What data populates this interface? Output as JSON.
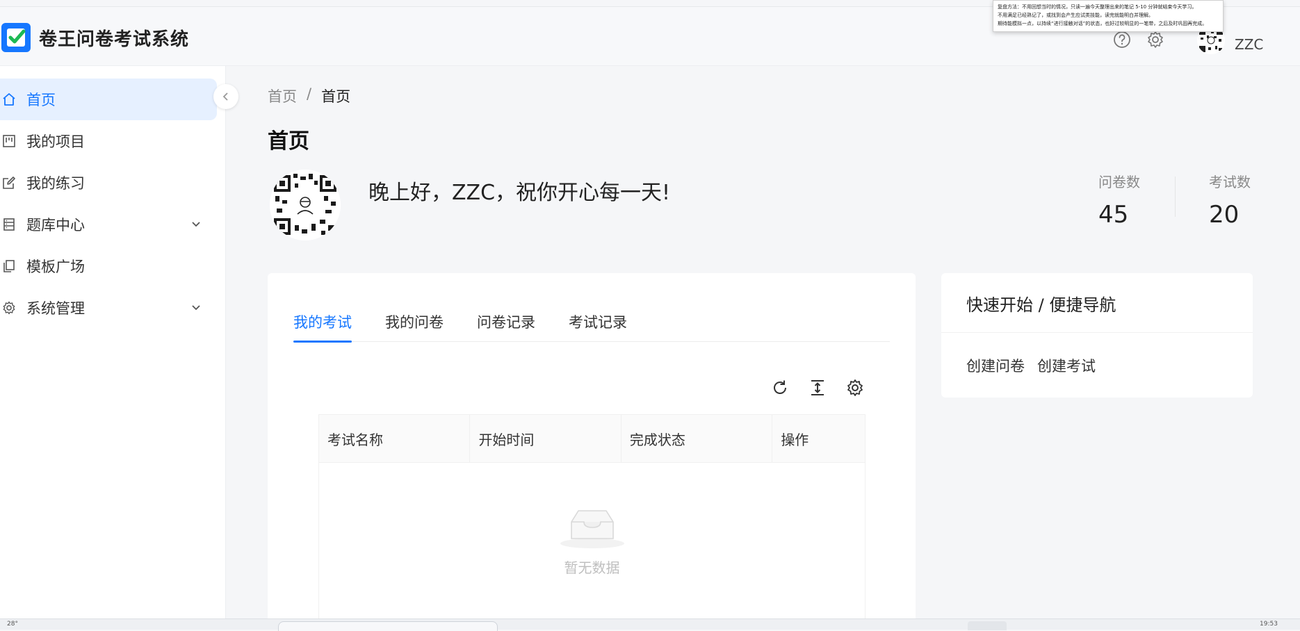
{
  "app": {
    "title": "卷王问卷考试系统",
    "username": "ZZC"
  },
  "popup": {
    "lines": [
      "复盘方法：不用回想当时的情况，只读一遍今天整理出来的笔记 5-10 分钟就结束今天学习。",
      "不用满足已经熟记了，或找到会产生应试类技能，读完就能明白并理解。",
      "期待能模拟一点，以持续“进行接触对话”的状态，也好过较明显的一笔带，之后及时巩固再完成。"
    ]
  },
  "sidebar": {
    "items": [
      {
        "label": "首页",
        "icon": "home-icon",
        "active": true
      },
      {
        "label": "我的项目",
        "icon": "project-icon",
        "active": false
      },
      {
        "label": "我的练习",
        "icon": "edit-icon",
        "active": false
      },
      {
        "label": "题库中心",
        "icon": "database-icon",
        "active": false,
        "expandable": true
      },
      {
        "label": "模板广场",
        "icon": "copy-icon",
        "active": false
      },
      {
        "label": "系统管理",
        "icon": "gear-icon",
        "active": false,
        "expandable": true
      }
    ]
  },
  "breadcrumb": {
    "items": [
      "首页",
      "首页"
    ],
    "separator": "/"
  },
  "page": {
    "title": "首页",
    "greeting": "晚上好，ZZC，祝你开心每一天!"
  },
  "stats": {
    "survey": {
      "label": "问卷数",
      "value": "45"
    },
    "exam": {
      "label": "考试数",
      "value": "20"
    }
  },
  "tabs": [
    "我的考试",
    "我的问卷",
    "问卷记录",
    "考试记录"
  ],
  "table": {
    "columns": [
      "考试名称",
      "开始时间",
      "完成状态",
      "操作"
    ],
    "rows": [],
    "empty_text": "暂无数据"
  },
  "quick_nav": {
    "title": "快速开始 / 便捷导航",
    "links": [
      "创建问卷",
      "创建考试"
    ]
  },
  "taskbar": {
    "left_text": "28°",
    "right_text": "19:53"
  },
  "colors": {
    "accent": "#1677ff",
    "active_bg": "#e6f0ff"
  }
}
